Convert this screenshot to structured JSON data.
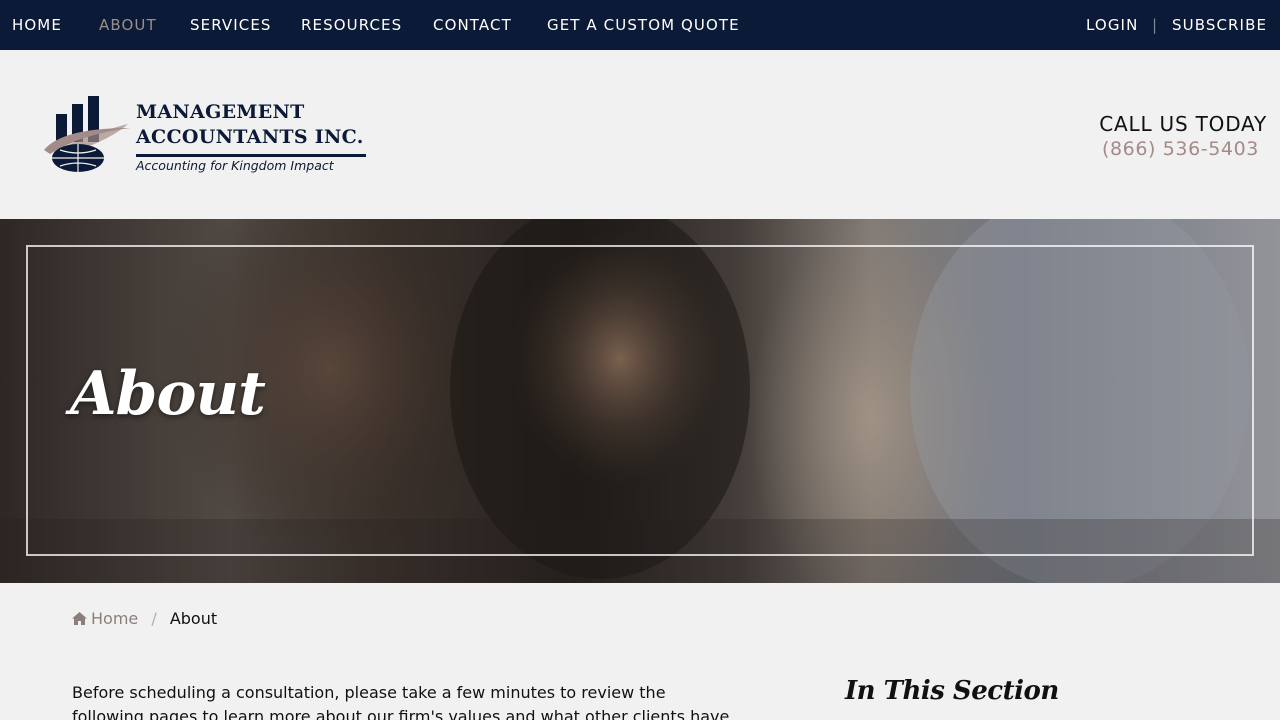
{
  "topnav": {
    "left": [
      {
        "label": "HOME",
        "active": false
      },
      {
        "label": "ABOUT",
        "active": true
      },
      {
        "label": "SERVICES",
        "active": false
      },
      {
        "label": "RESOURCES",
        "active": false
      },
      {
        "label": "CONTACT",
        "active": false
      },
      {
        "label": "GET A CUSTOM QUOTE",
        "active": false
      }
    ],
    "right": {
      "login": "LOGIN",
      "separator": "|",
      "subscribe": "SUBSCRIBE"
    }
  },
  "logo": {
    "line1": "MANAGEMENT",
    "line2": "ACCOUNTANTS INC.",
    "tagline": "Accounting for Kingdom Impact"
  },
  "call": {
    "title": "CALL US TODAY",
    "phone": "(866) 536-5403"
  },
  "hero": {
    "title": "About"
  },
  "breadcrumb": {
    "home": "Home",
    "separator": "/",
    "current": "About"
  },
  "content": {
    "intro": "Before scheduling a consultation, please take a few minutes to review the following pages to learn more about our firm's values and what other clients have",
    "aside_title": "In This Section"
  },
  "colors": {
    "nav_bg": "#0b1a36",
    "nav_active": "#9a8f8c",
    "accent": "#a38b87",
    "page_bg": "#f2f1f1"
  }
}
